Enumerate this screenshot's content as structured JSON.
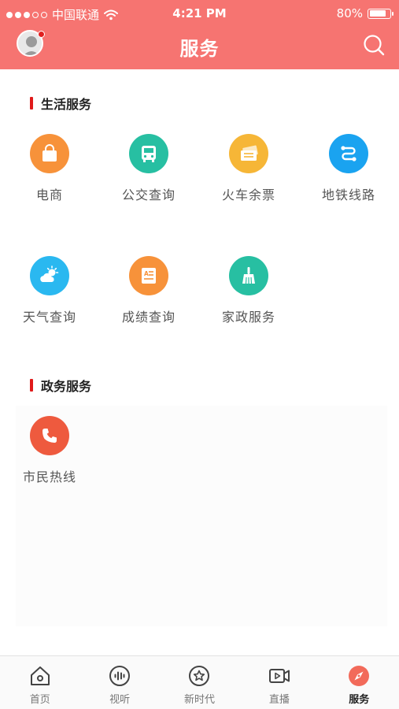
{
  "status_bar": {
    "carrier": "中国联通",
    "time": "4:21 PM",
    "battery_text": "80%",
    "battery_level": 0.8
  },
  "header": {
    "title": "服务",
    "color": "#f67471",
    "has_notification_dot": true
  },
  "sections": [
    {
      "title": "生活服务",
      "items": [
        {
          "label": "电商",
          "icon": "shopping-bag-icon",
          "color": "#f7923a"
        },
        {
          "label": "公交查询",
          "icon": "bus-icon",
          "color": "#27bfa2"
        },
        {
          "label": "火车余票",
          "icon": "train-ticket-icon",
          "color": "#f6b637"
        },
        {
          "label": "地铁线路",
          "icon": "subway-route-icon",
          "color": "#1aa3f0"
        },
        {
          "label": "天气查询",
          "icon": "weather-icon",
          "color": "#2ab8f0"
        },
        {
          "label": "成绩查询",
          "icon": "score-report-icon",
          "color": "#f7923a"
        },
        {
          "label": "家政服务",
          "icon": "broom-icon",
          "color": "#27bfa2"
        }
      ]
    },
    {
      "title": "政务服务",
      "items": [
        {
          "label": "市民热线",
          "icon": "phone-icon",
          "color": "#ee5a3e"
        }
      ]
    }
  ],
  "tabbar": {
    "active_color": "#f26a5a",
    "items": [
      {
        "label": "首页",
        "icon": "home-icon",
        "active": false
      },
      {
        "label": "视听",
        "icon": "audio-icon",
        "active": false
      },
      {
        "label": "新时代",
        "icon": "star-icon",
        "active": false
      },
      {
        "label": "直播",
        "icon": "live-video-icon",
        "active": false
      },
      {
        "label": "服务",
        "icon": "compass-icon",
        "active": true
      }
    ]
  }
}
